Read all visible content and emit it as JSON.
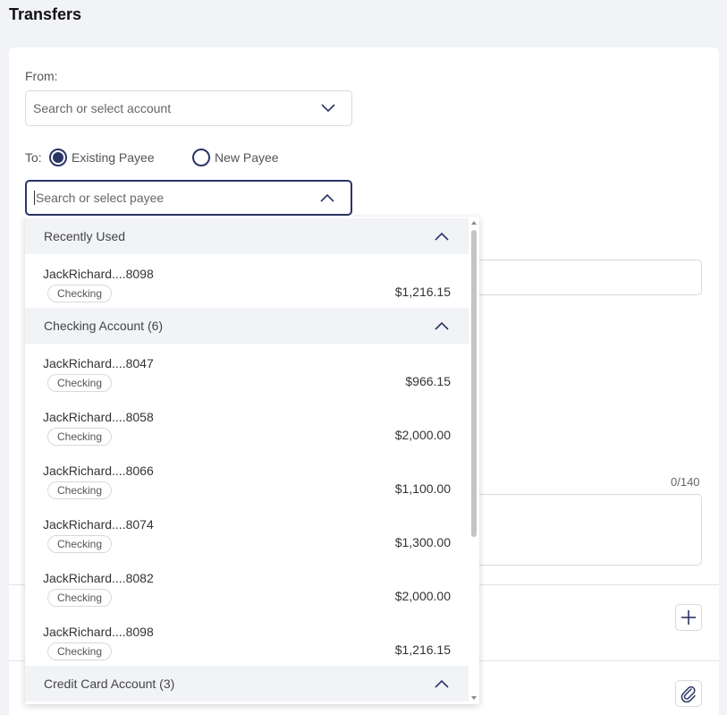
{
  "page": {
    "title": "Transfers"
  },
  "from": {
    "label": "From:",
    "placeholder": "Search or select account"
  },
  "to": {
    "label": "To:",
    "options": [
      {
        "label": "Existing Payee",
        "selected": true
      },
      {
        "label": "New Payee",
        "selected": false
      }
    ],
    "placeholder": "Search or select payee"
  },
  "memo": {
    "counter": "0/140"
  },
  "dropdown": {
    "groups": [
      {
        "title": "Recently Used",
        "items": [
          {
            "name": "JackRichard....8098",
            "type": "Checking",
            "amount": "$1,216.15"
          }
        ]
      },
      {
        "title": "Checking Account (6)",
        "items": [
          {
            "name": "JackRichard....8047",
            "type": "Checking",
            "amount": "$966.15"
          },
          {
            "name": "JackRichard....8058",
            "type": "Checking",
            "amount": "$2,000.00"
          },
          {
            "name": "JackRichard....8066",
            "type": "Checking",
            "amount": "$1,100.00"
          },
          {
            "name": "JackRichard....8074",
            "type": "Checking",
            "amount": "$1,300.00"
          },
          {
            "name": "JackRichard....8082",
            "type": "Checking",
            "amount": "$2,000.00"
          },
          {
            "name": "JackRichard....8098",
            "type": "Checking",
            "amount": "$1,216.15"
          }
        ]
      },
      {
        "title": "Credit Card Account (3)",
        "items": []
      }
    ]
  },
  "colors": {
    "accent": "#2a3566",
    "header_bg": "#f1f3f6",
    "border": "#d6d9de"
  },
  "icons": {
    "add": "plus-icon",
    "attach": "paperclip-icon"
  }
}
